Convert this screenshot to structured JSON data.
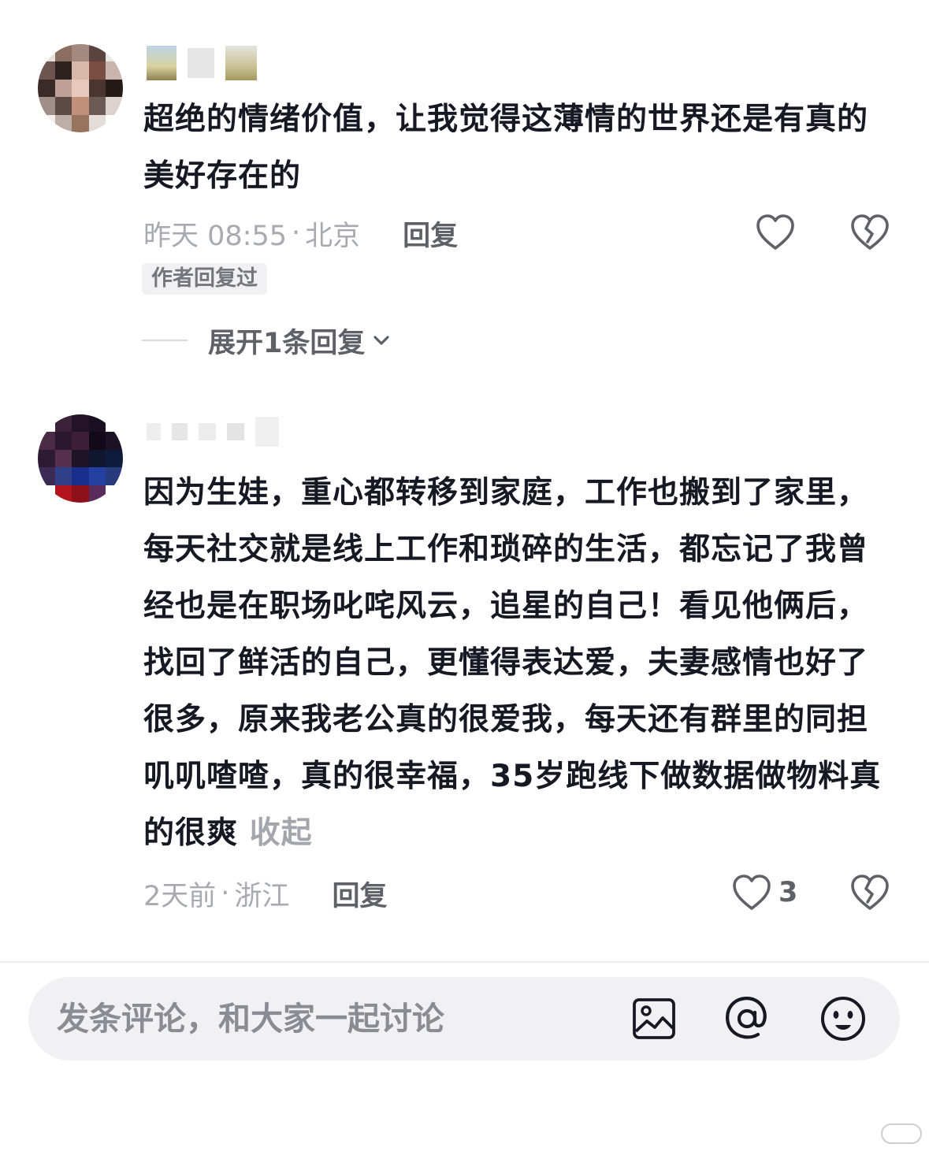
{
  "comments": [
    {
      "text": "超绝的情绪价值，让我觉得这薄情的世界还是有真的美好存在的",
      "time": "昨天 08:55",
      "location": "北京",
      "reply_label": "回复",
      "badge": "作者回复过",
      "expand_label": "展开1条回复",
      "like_count": ""
    },
    {
      "text": "因为生娃，重心都转移到家庭，工作也搬到了家里，每天社交就是线上工作和琐碎的生活，都忘记了我曾经也是在职场叱咤风云，追星的自己！看见他俩后，找回了鲜活的自己，更懂得表达爱，夫妻感情也好了很多，原来我老公真的很爱我，每天还有群里的同担叽叽喳喳，真的很幸福，35岁跑线下做数据做物料真的很爽",
      "collapse_label": "收起",
      "time": "2天前",
      "location": "浙江",
      "reply_label": "回复",
      "like_count": "3"
    }
  ],
  "input": {
    "placeholder": "发条评论，和大家一起讨论"
  },
  "icons": [
    "heart-icon",
    "dislike-heart-icon",
    "chevron-down-icon",
    "image-icon",
    "at-icon",
    "emoji-icon"
  ]
}
